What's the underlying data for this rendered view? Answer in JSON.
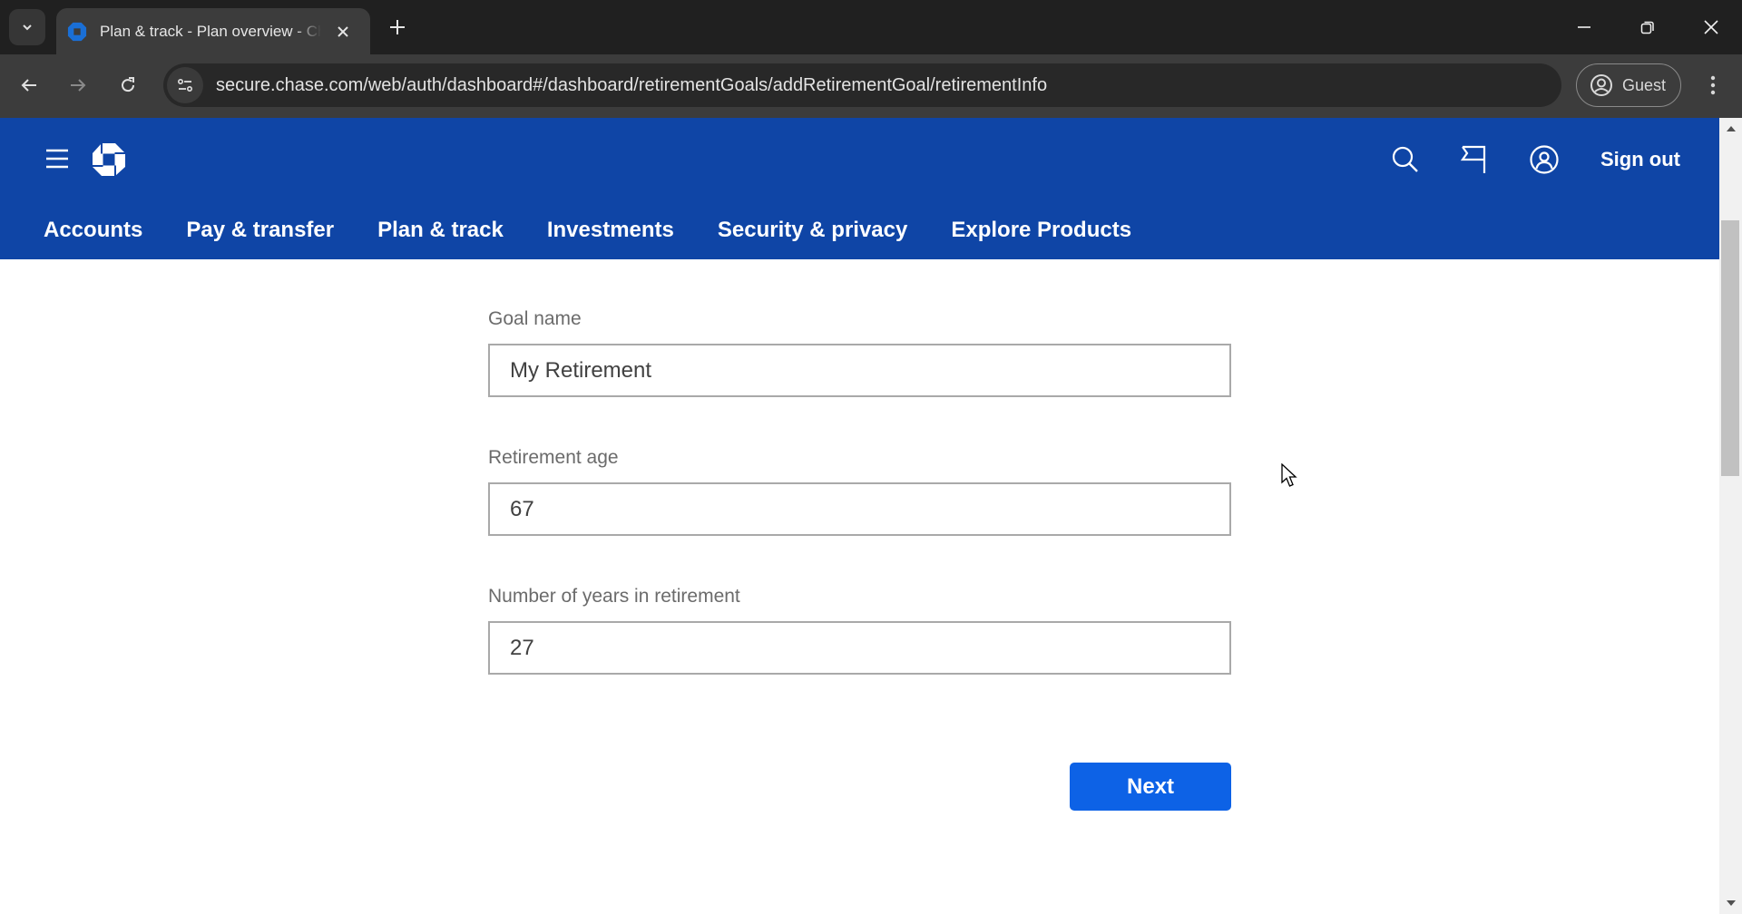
{
  "browser": {
    "tab_title": "Plan & track - Plan overview - Chase",
    "url": "secure.chase.com/web/auth/dashboard#/dashboard/retirementGoals/addRetirementGoal/retirementInfo",
    "profile_label": "Guest",
    "icons": {
      "tab_search": "chevron-down-icon",
      "favicon": "chase-logo-icon",
      "tab_close": "close-icon",
      "new_tab": "plus-icon",
      "minimize": "minimize-icon",
      "restore": "restore-icon",
      "close_window": "close-icon",
      "back": "arrow-left-icon",
      "forward": "arrow-right-icon",
      "reload": "reload-icon",
      "site_info": "tune-icon",
      "profile": "account-circle-icon",
      "menu": "kebab-icon"
    }
  },
  "header": {
    "sign_out_label": "Sign out",
    "icons": {
      "menu": "hamburger-icon",
      "logo": "chase-logo-icon",
      "search": "search-icon",
      "messages": "flag-icon",
      "profile": "profile-icon"
    },
    "nav": [
      {
        "label": "Accounts"
      },
      {
        "label": "Pay & transfer"
      },
      {
        "label": "Plan & track"
      },
      {
        "label": "Investments"
      },
      {
        "label": "Security & privacy"
      },
      {
        "label": "Explore Products"
      }
    ]
  },
  "form": {
    "fields": [
      {
        "label": "Goal name",
        "value": "My Retirement"
      },
      {
        "label": "Retirement age",
        "value": "67"
      },
      {
        "label": "Number of years in retirement",
        "value": "27"
      }
    ],
    "next_label": "Next"
  },
  "colors": {
    "header_blue": "#0f45a6",
    "button_blue": "#0d62e6",
    "label_gray": "#6b6b6b"
  }
}
